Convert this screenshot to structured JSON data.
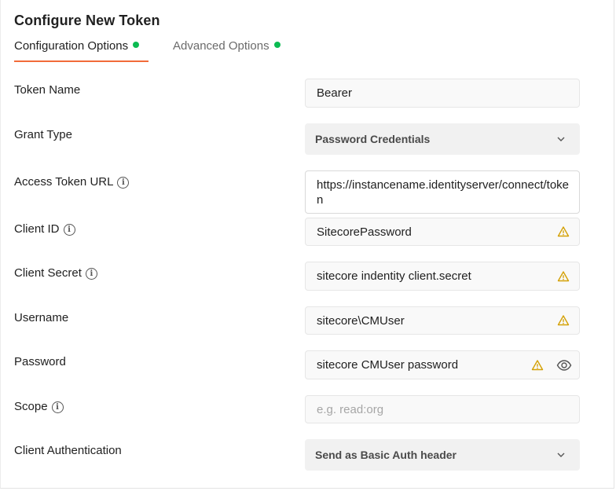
{
  "title": "Configure New Token",
  "tabs": [
    {
      "label": "Configuration Options",
      "active": true,
      "status_color": "#0cbb52"
    },
    {
      "label": "Advanced Options",
      "active": false,
      "status_color": "#0cbb52"
    }
  ],
  "accent_color": "#f26b3a",
  "fields": {
    "token_name": {
      "label": "Token Name",
      "value": "Bearer"
    },
    "grant_type": {
      "label": "Grant Type",
      "value": "Password Credentials"
    },
    "access_token_url": {
      "label": "Access Token URL",
      "value": "https://instancename.identityserver/connect/token"
    },
    "client_id": {
      "label": "Client ID",
      "value": "SitecorePassword"
    },
    "client_secret": {
      "label": "Client Secret",
      "value": "sitecore indentity client.secret"
    },
    "username": {
      "label": "Username",
      "value": "sitecore\\CMUser"
    },
    "password": {
      "label": "Password",
      "value": "sitecore CMUser password"
    },
    "scope": {
      "label": "Scope",
      "value": "",
      "placeholder": "e.g. read:org"
    },
    "client_authentication": {
      "label": "Client Authentication",
      "value": "Send as Basic Auth header"
    }
  },
  "icons": {
    "info": "info-icon",
    "warning": "warning-icon",
    "dropdown": "chevron-down-icon",
    "reveal": "eye-icon"
  },
  "warning_color": "#d4a106"
}
